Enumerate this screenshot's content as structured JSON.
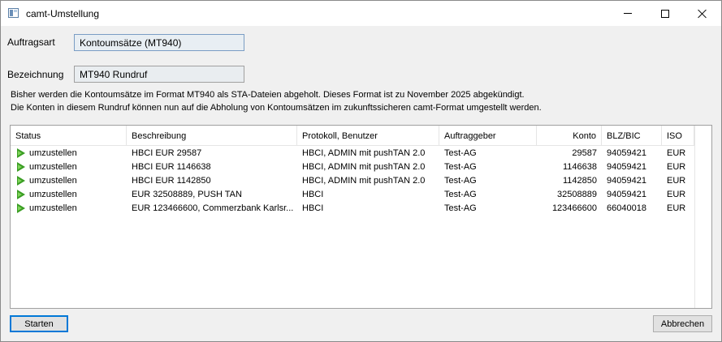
{
  "window": {
    "title": "camt-Umstellung"
  },
  "form": {
    "auftragsart_label": "Auftragsart",
    "auftragsart_value": "Kontoumsätze (MT940)",
    "bezeichnung_label": "Bezeichnung",
    "bezeichnung_value": "MT940 Rundruf"
  },
  "info": {
    "line1": "Bisher werden die Kontoumsätze im Format MT940 als STA-Dateien abgeholt. Dieses Format ist zu November 2025 abgekündigt.",
    "line2": "Die Konten in diesem Rundruf können nun auf die Abholung von Kontoumsätzen im zukunftssicheren camt-Format umgestellt werden."
  },
  "table": {
    "columns": [
      "Status",
      "Beschreibung",
      "Protokoll, Benutzer",
      "Auftraggeber",
      "Konto",
      "BLZ/BIC",
      "ISO"
    ],
    "rows": [
      {
        "status": "umzustellen",
        "beschreibung": "HBCI EUR 29587",
        "protokoll": "HBCI, ADMIN mit pushTAN 2.0",
        "auftraggeber": "Test-AG",
        "konto": "29587",
        "blz": "94059421",
        "iso": "EUR",
        "status_icon": "play-green-icon"
      },
      {
        "status": "umzustellen",
        "beschreibung": "HBCI EUR 1146638",
        "protokoll": "HBCI, ADMIN mit pushTAN 2.0",
        "auftraggeber": "Test-AG",
        "konto": "1146638",
        "blz": "94059421",
        "iso": "EUR",
        "status_icon": "play-green-icon"
      },
      {
        "status": "umzustellen",
        "beschreibung": "HBCI EUR 1142850",
        "protokoll": "HBCI, ADMIN mit pushTAN 2.0",
        "auftraggeber": "Test-AG",
        "konto": "1142850",
        "blz": "94059421",
        "iso": "EUR",
        "status_icon": "play-green-icon"
      },
      {
        "status": "umzustellen",
        "beschreibung": "EUR 32508889, PUSH TAN",
        "protokoll": "HBCI",
        "auftraggeber": "Test-AG",
        "konto": "32508889",
        "blz": "94059421",
        "iso": "EUR",
        "status_icon": "play-green-icon"
      },
      {
        "status": "umzustellen",
        "beschreibung": "EUR 123466600, Commerzbank Karlsr...",
        "protokoll": "HBCI",
        "auftraggeber": "Test-AG",
        "konto": "123466600",
        "blz": "66040018",
        "iso": "EUR",
        "status_icon": "play-green-icon"
      }
    ]
  },
  "buttons": {
    "start_label": "Starten",
    "cancel_label": "Abbrechen"
  },
  "colors": {
    "accent": "#0078d7",
    "status_green": "#3a9d23"
  }
}
